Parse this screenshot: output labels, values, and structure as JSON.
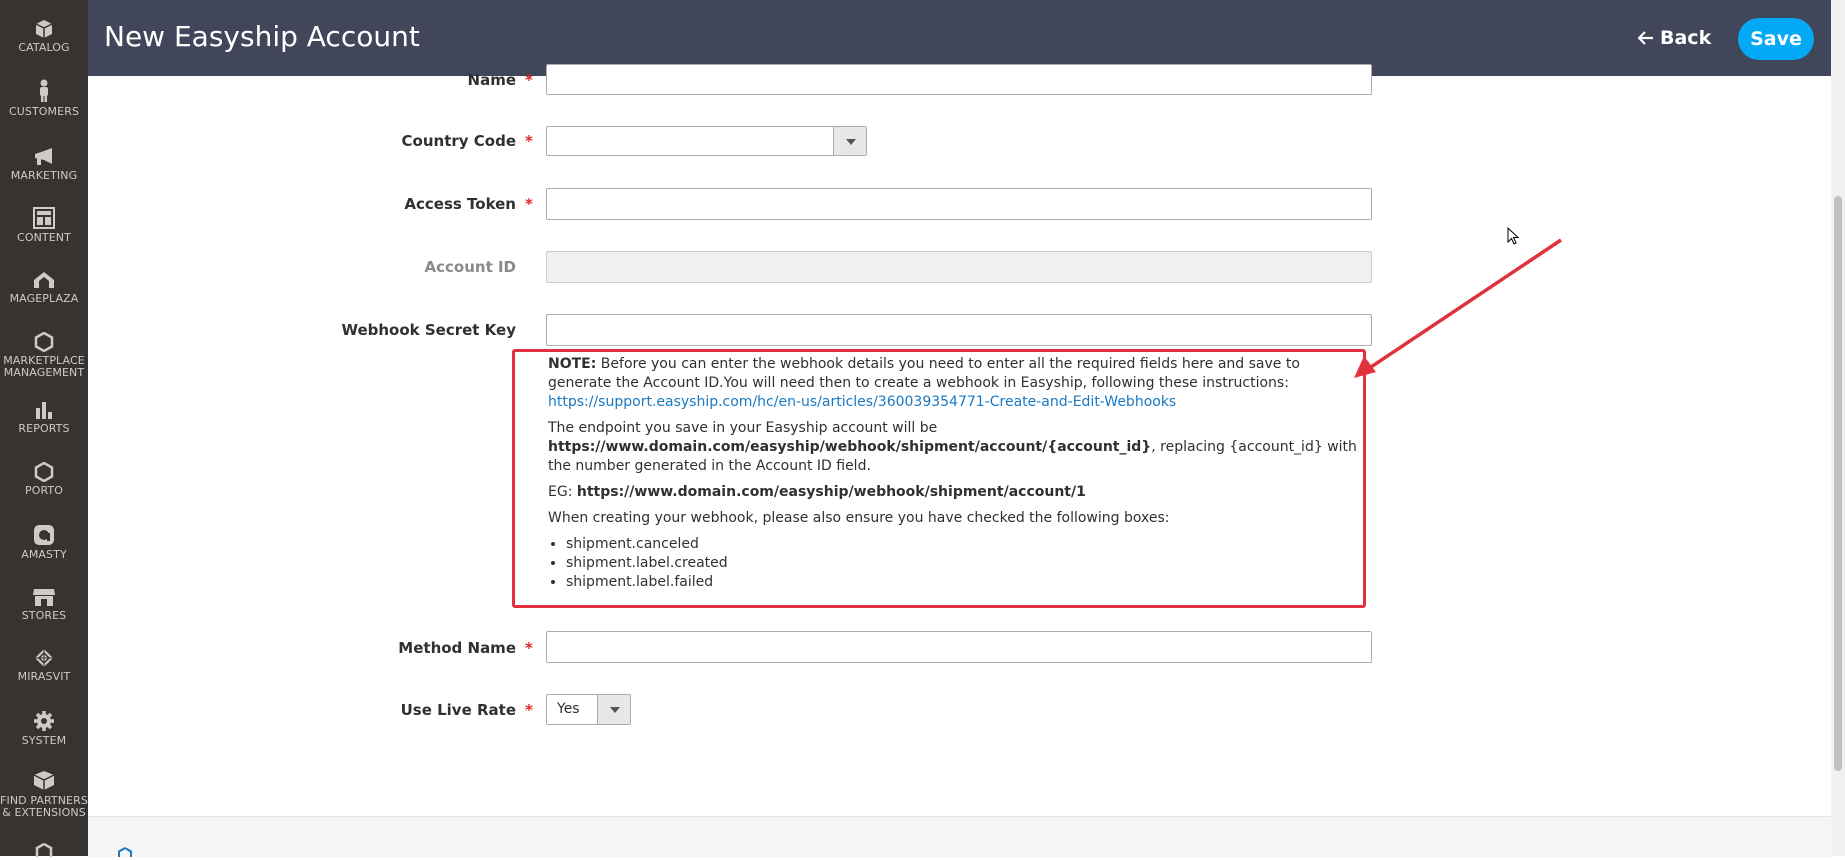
{
  "sidebar": {
    "items": [
      {
        "label": "CATALOG",
        "icon": "cube-icon"
      },
      {
        "label": "CUSTOMERS",
        "icon": "person-icon"
      },
      {
        "label": "MARKETING",
        "icon": "megaphone-icon"
      },
      {
        "label": "CONTENT",
        "icon": "layout-icon"
      },
      {
        "label": "MAGEPLAZA",
        "icon": "mageplaza-icon"
      },
      {
        "label": "MARKETPLACE MANAGEMENT",
        "icon": "hexagon-icon"
      },
      {
        "label": "REPORTS",
        "icon": "bar-chart-icon"
      },
      {
        "label": "PORTO",
        "icon": "hexagon-icon"
      },
      {
        "label": "AMASTY",
        "icon": "amasty-icon"
      },
      {
        "label": "STORES",
        "icon": "store-icon"
      },
      {
        "label": "MIRASVIT",
        "icon": "mirasvit-icon"
      },
      {
        "label": "SYSTEM",
        "icon": "gear-icon"
      },
      {
        "label": "FIND PARTNERS & EXTENSIONS",
        "icon": "boxes-icon"
      }
    ]
  },
  "header": {
    "title": "New Easyship Account",
    "back_label": "Back",
    "save_label": "Save",
    "background": "#41465a",
    "accent": "#03a9f4"
  },
  "form": {
    "name_label": "Name",
    "country_code_label": "Country Code",
    "country_code_value": "",
    "access_token_label": "Access Token",
    "account_id_label": "Account ID",
    "webhook_label": "Webhook Secret Key",
    "method_name_label": "Method Name",
    "live_rate_label": "Use Live Rate",
    "live_rate_value": "Yes",
    "required_mark": "*"
  },
  "note": {
    "note_prefix": "NOTE:",
    "note_text": " Before you can enter the webhook details you need to enter all the required fields here and save to generate the Account ID.You will need then to create a webhook in Easyship, following these instructions:",
    "link": "https://support.easyship.com/hc/en-us/articles/360039354771-Create-and-Edit-Webhooks",
    "endpoint_intro": "The endpoint you save in your Easyship account will be",
    "endpoint_url": "https://www.domain.com/easyship/webhook/shipment/account/{account_id}",
    "endpoint_suffix": ", replacing {account_id} with the number generated in the Account ID field.",
    "eg_prefix": "EG: ",
    "eg_url": "https://www.domain.com/easyship/webhook/shipment/account/1",
    "checkbox_intro": "When creating your webhook, please also ensure you have checked the following boxes:",
    "checkboxes": [
      "shipment.canceled",
      "shipment.label.created",
      "shipment.label.failed"
    ],
    "highlight_color": "#e0313d"
  }
}
